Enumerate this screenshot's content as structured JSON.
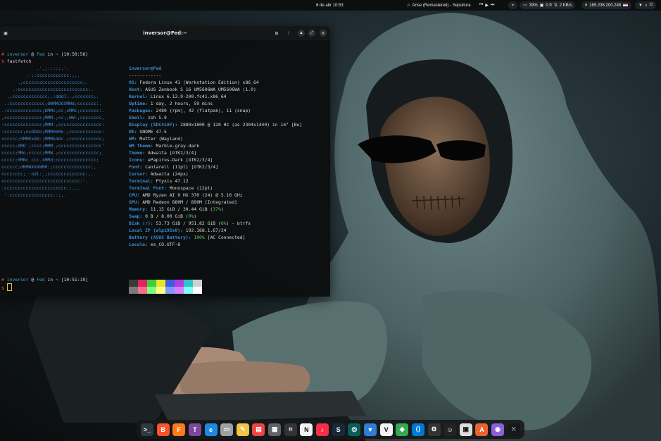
{
  "topbar": {
    "date_time": "6 de abr  10:53",
    "media": "Arise (Remastered) - Sepultura",
    "battery": "39%",
    "cpu": "0.9",
    "net_speed": "2 KB/s",
    "vpn_ip": "185.236.200.245"
  },
  "terminal": {
    "title": "inversor@Fed:~",
    "prompt1": {
      "user": "inversor",
      "at": " @ ",
      "host": "Fed",
      "in": " in ~ ",
      "time": "[10:50:56]"
    },
    "command": "fastfetch",
    "prompt2": {
      "user": "inversor",
      "at": " @ ",
      "host": "Fed",
      "in": " in ~ ",
      "time": "[10:51:19]"
    },
    "dollar": "$",
    "header": "inversor@Fed",
    "separator": "------------",
    "info": [
      {
        "key": "OS:",
        "value": " Fedora Linux 41 (Workstation Edition) x86_64"
      },
      {
        "key": "Host:",
        "value": " ASUS Zenbook S 16 UM5606WA_UM5606WA (1.0)"
      },
      {
        "key": "Kernel:",
        "value": " Linux 6.13.9-200.fc41.x86_64"
      },
      {
        "key": "Uptime:",
        "value": " 1 day, 2 hours, 59 mins"
      },
      {
        "key": "Packages:",
        "value": " 2480 (rpm), 42 (flatpak), 11 (snap)"
      },
      {
        "key": "Shell:",
        "value": " zsh 5.9"
      },
      {
        "key": "Display (SDC41AF):",
        "value": " 2880x1800 @ 120 Hz (as 2304x1440) in 16\" [Bu]"
      },
      {
        "key": "DE:",
        "value": " GNOME 47.5"
      },
      {
        "key": "WM:",
        "value": " Mutter (Wayland)"
      },
      {
        "key": "WM Theme:",
        "value": " Marble-gray-dark"
      },
      {
        "key": "Theme:",
        "value": " Adwaita [GTK2/3/4]"
      },
      {
        "key": "Icons:",
        "value": " ePapirus-Dark [GTK2/3/4]"
      },
      {
        "key": "Font:",
        "value": " Cantarell (11pt) [GTK2/3/4]"
      },
      {
        "key": "Cursor:",
        "value": " Adwaita (24px)"
      },
      {
        "key": "Terminal:",
        "value": " Ptyxis 47.12"
      },
      {
        "key": "Terminal Font:",
        "value": " Monospace (12pt)"
      },
      {
        "key": "CPU:",
        "value": " AMD Ryzen AI 9 HX 370 (24) @ 5.16 GHz"
      },
      {
        "key": "GPU:",
        "value": " AMD Radeon 880M / 890M [Integrated]"
      },
      {
        "key": "Memory:",
        "value": " 11.15 GiB / 30.44 GiB (",
        "pct": "37%",
        "tail": ")"
      },
      {
        "key": "Swap:",
        "value": " 0 B / 8.00 GiB (",
        "pct": "0%",
        "tail": ")"
      },
      {
        "key": "Disk (/):",
        "value": " 53.73 GiB / 951.82 GiB (",
        "pct": "6%",
        "tail": ") - btrfs"
      },
      {
        "key": "Local IP (wlp195s0):",
        "value": " 192.168.1.67/24"
      },
      {
        "key": "Battery (ASUS Battery):",
        "value": " ",
        "pct": "100%",
        "tail": " [AC Connected]"
      },
      {
        "key": "Locale:",
        "value": " es_CO.UTF-8"
      }
    ],
    "logo_lines": [
      "             .',;::::;,'.",
      "         .';:cccccccccccc:;,.",
      "      .;cccccccccccccccccccccc;.",
      "    .:cccccccccccccccccccccccccc:.",
      "  .;ccccccccccccc;.:dddl:.;ccccccc;.",
      " .:ccccccccccccc;OWMKOOXMWd;ccccccc:.",
      ".:ccccccccccccc;KMMc;cc;xMMc;ccccccc:.",
      ",cccccccccccccc;MMM.;cc;;WW:;cccccccc,",
      ":cccccccccccccc;MMM.;cccccccccccccccc:",
      ":ccccccc;oxOOOo;MMM000k.;cccccccccccc:",
      "cccccc;0MMKxdd:;MMMkddc.;cccccccccccc;",
      "ccccc;XMO';cccc;MMM.;cccccccccccccccc'",
      "ccccc;MMo;ccccc;MMW.;ccccccccccccccc;",
      "ccccc;0MNc.ccc.xMMd;ccccccccccccccc;",
      "cccccc;dNMWXXXWM0:;cccccccccccccc:,",
      "cccccccc;.:odl:.;cccccccccccccc:,.",
      "ccccccccccccccccccccccccccccc:'.",
      ":ccccccccccccccccccccccc:;,..",
      " ':cccccccccccccccc::;,."
    ],
    "palette": [
      "#3a3a3a",
      "#e0245e",
      "#3ecf3e",
      "#e6e62e",
      "#3a5fe0",
      "#b23ee0",
      "#2ec6c6",
      "#d0d0d0",
      "#7a7a7a",
      "#ff6a8e",
      "#7fff7f",
      "#ffff7f",
      "#7f9aff",
      "#d87fff",
      "#7fffff",
      "#ffffff"
    ]
  },
  "dock": {
    "apps": [
      {
        "name": "terminal-icon",
        "glyph": ">_",
        "bg": "#2b3a45"
      },
      {
        "name": "brave-icon",
        "glyph": "B",
        "bg": "#fb542b"
      },
      {
        "name": "firefox-icon",
        "glyph": "F",
        "bg": "#ff7a1a"
      },
      {
        "name": "tor-icon",
        "glyph": "T",
        "bg": "#7e4798"
      },
      {
        "name": "browser-icon",
        "glyph": "e",
        "bg": "#1e88e5"
      },
      {
        "name": "files-icon",
        "glyph": "▭",
        "bg": "#9aa0a6"
      },
      {
        "name": "text-editor-icon",
        "glyph": "✎",
        "bg": "#f4c542"
      },
      {
        "name": "document-viewer-icon",
        "glyph": "▤",
        "bg": "#e44"
      },
      {
        "name": "calculator-icon",
        "glyph": "▦",
        "bg": "#5f6368"
      },
      {
        "name": "screenshot-icon",
        "glyph": "⌗",
        "bg": "#333"
      },
      {
        "name": "notion-icon",
        "glyph": "N",
        "bg": "#f2f2f2"
      },
      {
        "name": "music-icon",
        "glyph": "♪",
        "bg": "#fa2d48"
      },
      {
        "name": "steam-icon",
        "glyph": "S",
        "bg": "#1b2838"
      },
      {
        "name": "network-tool-icon",
        "glyph": "◎",
        "bg": "#0b5d5d"
      },
      {
        "name": "vpn-icon",
        "glyph": "▼",
        "bg": "#2e7dd7"
      },
      {
        "name": "vim-icon",
        "glyph": "V",
        "bg": "#f2f2f2"
      },
      {
        "name": "maps-icon",
        "glyph": "◆",
        "bg": "#34a853"
      },
      {
        "name": "vscode-icon",
        "glyph": "⟨⟩",
        "bg": "#0078d4"
      },
      {
        "name": "pycharm-icon",
        "glyph": "⚙",
        "bg": "#333"
      },
      {
        "name": "cat-app-icon",
        "glyph": "☺",
        "bg": "#222"
      },
      {
        "name": "store-icon",
        "glyph": "▣",
        "bg": "#ddd"
      },
      {
        "name": "office-icon",
        "glyph": "A",
        "bg": "#e8642c"
      },
      {
        "name": "photo-app-icon",
        "glyph": "◉",
        "bg": "#8e5ed8"
      },
      {
        "name": "app-grid-icon",
        "glyph": "⁙",
        "bg": "#16181a"
      }
    ]
  }
}
